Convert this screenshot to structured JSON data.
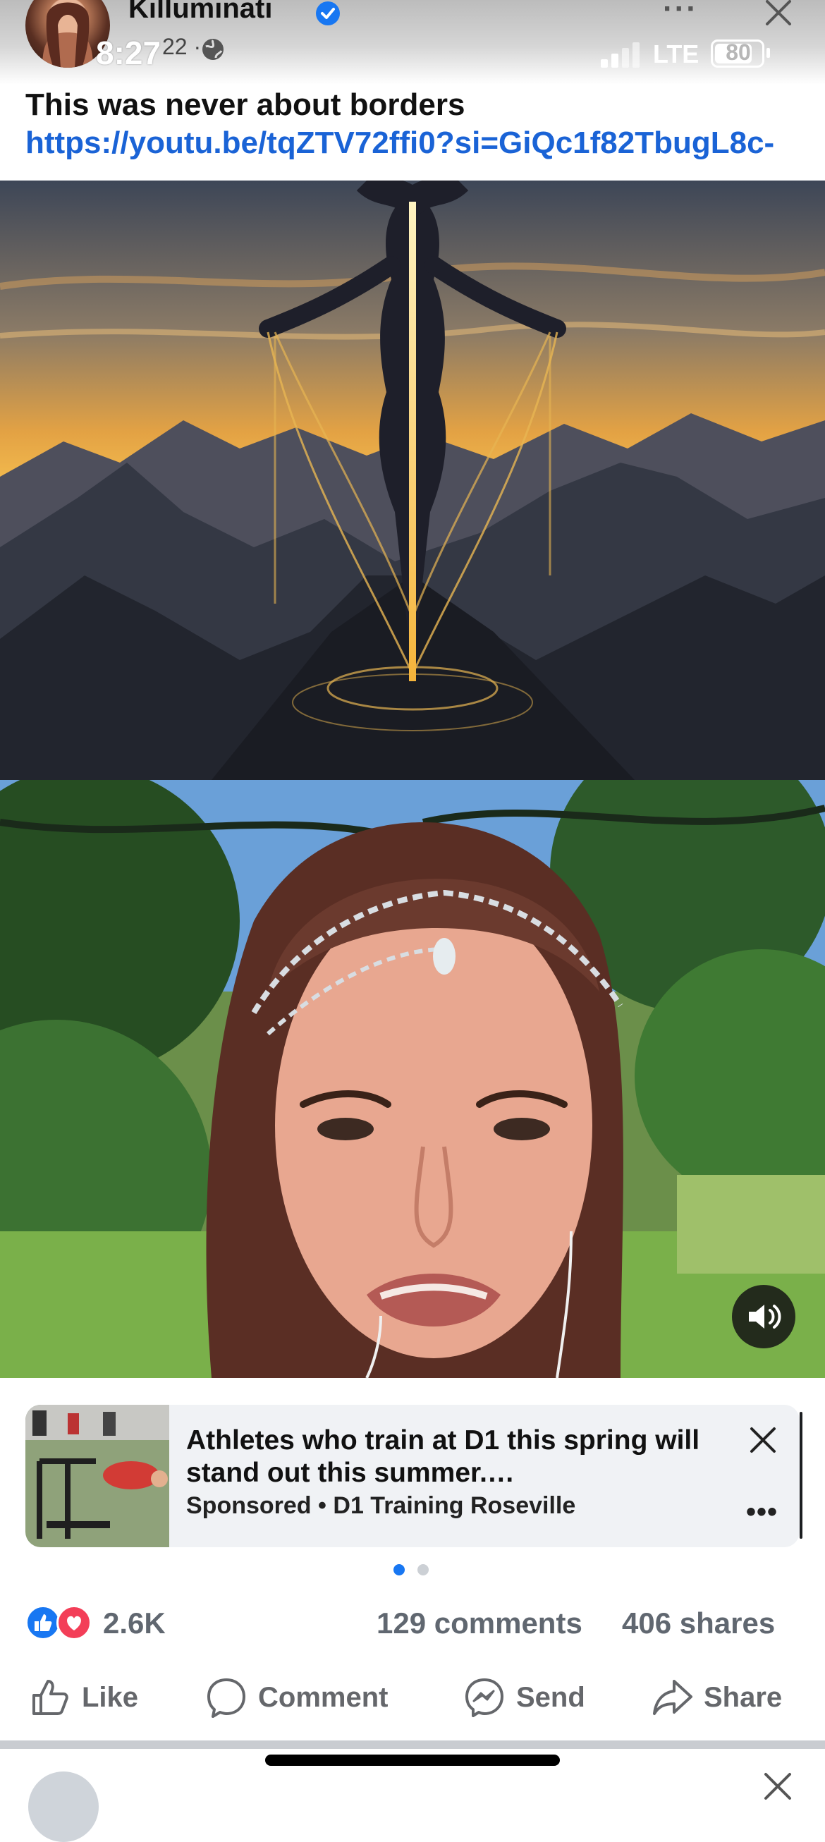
{
  "status_bar": {
    "time": "8:27",
    "network": "LTE",
    "battery": "80"
  },
  "post": {
    "page_name": "Killuminati",
    "meta_age": "22",
    "meta_separator": "·",
    "caption_text": "This was never about borders ",
    "caption_link": "https://youtu.be/tqZTV72ffi0?si=GiQc1f82TbugL8c-"
  },
  "ad": {
    "title": "Athletes who train at D1 this spring will stand out this summer.…",
    "sponsored_label": "Sponsored",
    "separator": "•",
    "advertiser": "D1 Training Roseville",
    "more": "•••"
  },
  "carousel": {
    "current_index": 1,
    "count": 2,
    "active_color": "#1877f2",
    "inactive_color": "#ccd0d5"
  },
  "engagement": {
    "reactions_count": "2.6K",
    "comments": "129 comments",
    "shares": "406 shares"
  },
  "actions": {
    "like": "Like",
    "comment": "Comment",
    "send": "Send",
    "share": "Share"
  },
  "colors": {
    "link": "#1a63d6",
    "like_blue": "#1877f2",
    "love_red": "#f33e58",
    "muted_text": "#65676b"
  },
  "icons": [
    "verified-badge-icon",
    "globe-icon",
    "more-icon",
    "close-icon",
    "volume-icon",
    "like-icon",
    "comment-icon",
    "messenger-icon",
    "share-icon"
  ]
}
